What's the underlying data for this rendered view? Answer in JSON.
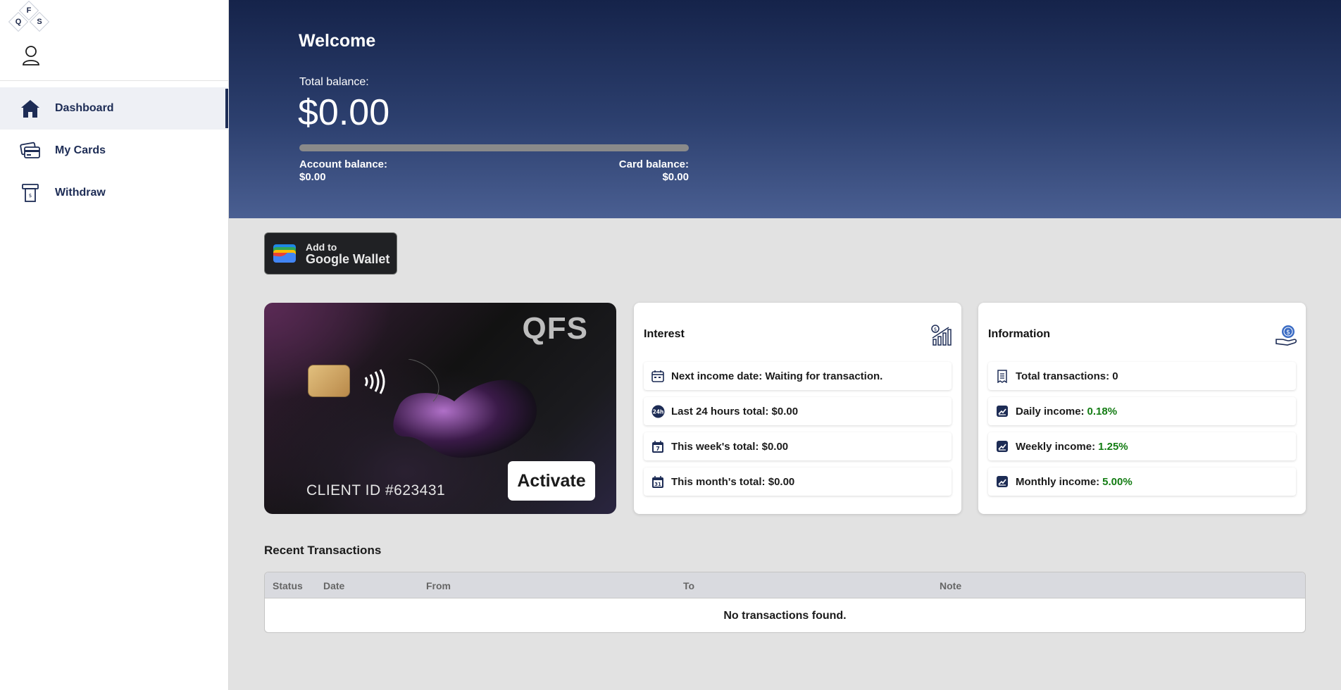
{
  "logo": {
    "letters": [
      "F",
      "Q",
      "S"
    ]
  },
  "sidebar": {
    "items": [
      {
        "label": "Dashboard",
        "icon": "home-icon",
        "active": true
      },
      {
        "label": "My Cards",
        "icon": "cards-icon"
      },
      {
        "label": "Withdraw",
        "icon": "atm-icon"
      }
    ]
  },
  "header": {
    "welcome": "Welcome",
    "total_balance_label": "Total balance:",
    "total_balance": "$0.00",
    "account_balance_label": "Account balance:",
    "account_balance": "$0.00",
    "card_balance_label": "Card balance:",
    "card_balance": "$0.00",
    "balance_progress": 0
  },
  "google_wallet": {
    "line1": "Add to",
    "line2": "Google Wallet"
  },
  "card": {
    "brand": "QFS",
    "client_id": "CLIENT ID #623431",
    "activate_label": "Activate"
  },
  "interest": {
    "title": "Interest",
    "rows": [
      {
        "icon": "calendar-icon",
        "text": "Next income date: Waiting for transaction."
      },
      {
        "icon": "24-hours-icon",
        "text": "Last 24 hours total: $0.00"
      },
      {
        "icon": "calendar-7-icon",
        "text": "This week's total: $0.00"
      },
      {
        "icon": "calendar-31-icon",
        "text": "This month's total: $0.00"
      }
    ]
  },
  "information": {
    "title": "Information",
    "rows": [
      {
        "icon": "receipt-icon",
        "text": "Total transactions: 0",
        "value": ""
      },
      {
        "icon": "chart-icon",
        "text": "Daily income:",
        "value": "0.18%"
      },
      {
        "icon": "chart-icon",
        "text": "Weekly income:",
        "value": "1.25%"
      },
      {
        "icon": "chart-icon",
        "text": "Monthly income:",
        "value": "5.00%"
      }
    ]
  },
  "transactions": {
    "title": "Recent Transactions",
    "columns": [
      "Status",
      "Date",
      "From",
      "To",
      "Note"
    ],
    "empty_message": "No transactions found."
  },
  "colors": {
    "navy": "#1d2c55",
    "positive": "#137c13"
  }
}
